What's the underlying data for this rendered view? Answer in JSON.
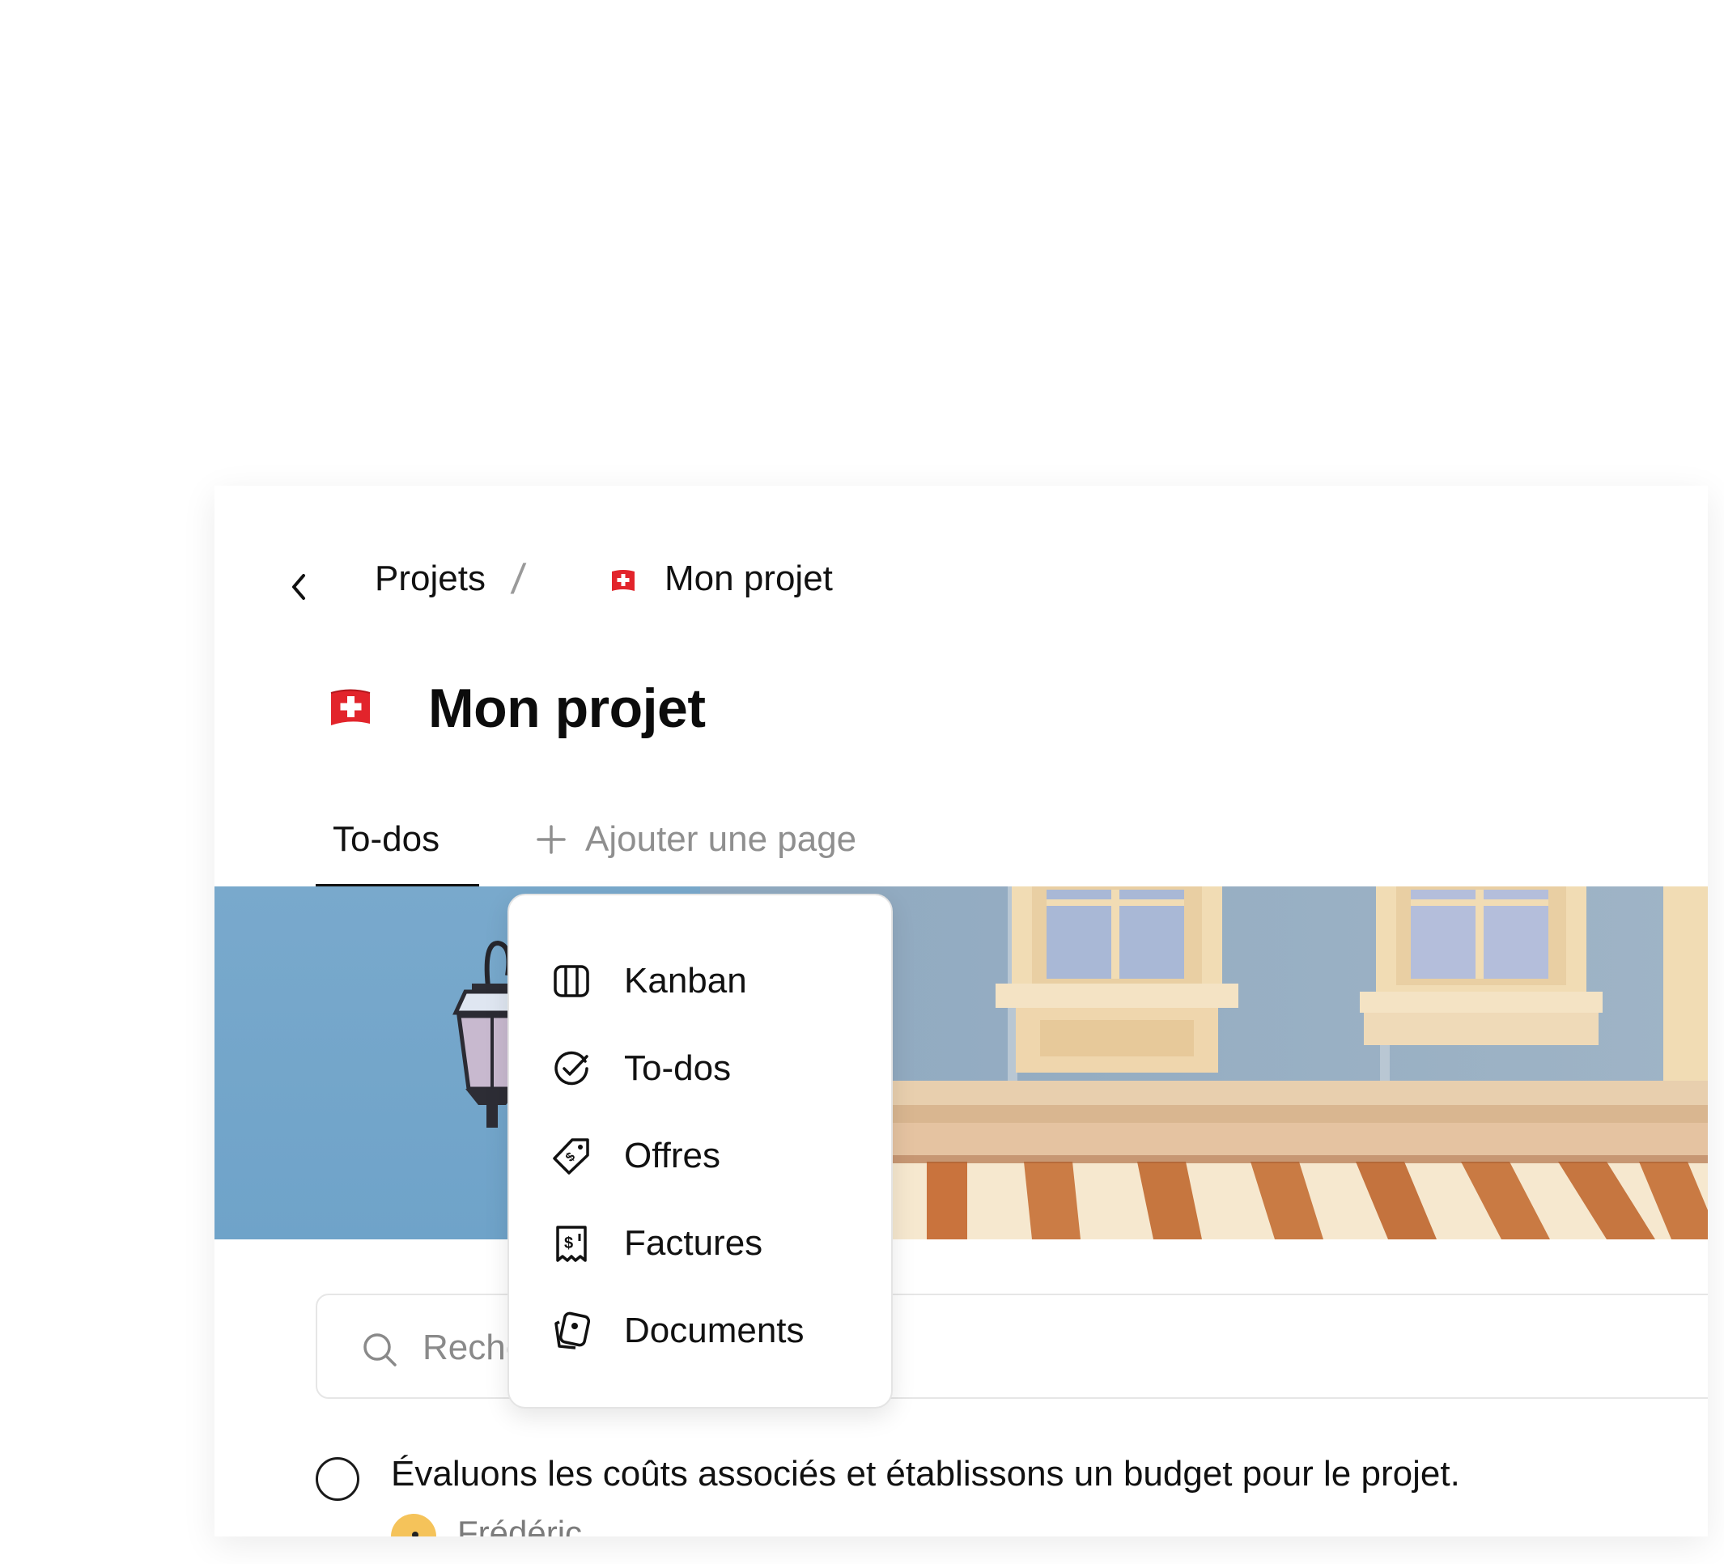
{
  "breadcrumb": {
    "back_icon": "chevron-left-icon",
    "parent": "Projets",
    "separator": "/",
    "current_flag": "swiss-flag",
    "current": "Mon projet"
  },
  "page": {
    "flag": "swiss-flag",
    "title": "Mon projet"
  },
  "tabs": {
    "active": "To-dos",
    "add_label": "Ajouter une page",
    "add_icon": "plus-icon"
  },
  "add_page_menu": {
    "items": [
      {
        "label": "Kanban",
        "icon": "kanban-icon"
      },
      {
        "label": "To-dos",
        "icon": "check-circle-icon"
      },
      {
        "label": "Offres",
        "icon": "price-tag-icon"
      },
      {
        "label": "Factures",
        "icon": "receipt-icon"
      },
      {
        "label": "Documents",
        "icon": "documents-icon"
      }
    ]
  },
  "search": {
    "placeholder": "Rechercher",
    "icon": "search-icon"
  },
  "todos": [
    {
      "text": "Évaluons les coûts associés et établissons un budget pour le projet.",
      "assignee": "Frédéric"
    }
  ],
  "colors": {
    "sky": "#7aa9cb",
    "building": "#94aec4",
    "window_frame": "#f2dcb6",
    "awning_brown": "#c97b45",
    "awning_cream": "#f7ead2",
    "flag_red": "#e2242b"
  }
}
